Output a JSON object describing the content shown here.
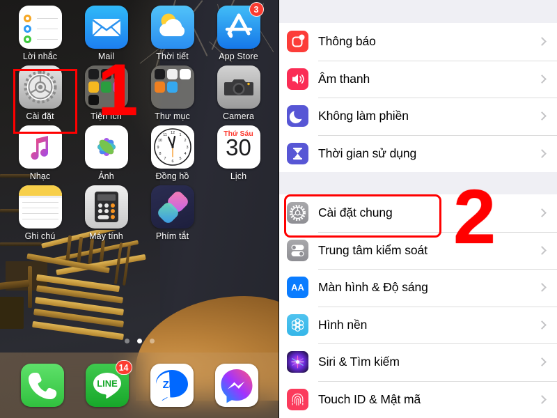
{
  "home_screen": {
    "apps": [
      {
        "id": "reminders",
        "label": "Lời nhắc",
        "icon": "reminders-icon",
        "badge": null
      },
      {
        "id": "mail",
        "label": "Mail",
        "icon": "mail-icon",
        "badge": null
      },
      {
        "id": "weather",
        "label": "Thời tiết",
        "icon": "weather-icon",
        "badge": null
      },
      {
        "id": "appstore",
        "label": "App Store",
        "icon": "app-store-icon",
        "badge": "3"
      },
      {
        "id": "settings",
        "label": "Cài đặt",
        "icon": "settings-gear-icon",
        "badge": null
      },
      {
        "id": "utilities",
        "label": "Tiện ích",
        "icon": "folder-icon",
        "badge": null
      },
      {
        "id": "folder",
        "label": "Thư mục",
        "icon": "folder-icon",
        "badge": null
      },
      {
        "id": "camera",
        "label": "Camera",
        "icon": "camera-icon",
        "badge": null
      },
      {
        "id": "music",
        "label": "Nhạc",
        "icon": "music-note-icon",
        "badge": null
      },
      {
        "id": "photos",
        "label": "Ảnh",
        "icon": "photos-flower-icon",
        "badge": null
      },
      {
        "id": "clock",
        "label": "Đồng hồ",
        "icon": "clock-icon",
        "badge": null
      },
      {
        "id": "calendar",
        "label": "Lịch",
        "icon": "calendar-icon",
        "badge": null
      },
      {
        "id": "notes",
        "label": "Ghi chú",
        "icon": "notes-icon",
        "badge": null
      },
      {
        "id": "calculator",
        "label": "Máy tính",
        "icon": "calculator-icon",
        "badge": null
      },
      {
        "id": "shortcuts",
        "label": "Phím tắt",
        "icon": "shortcuts-icon",
        "badge": null
      }
    ],
    "calendar_icon": {
      "weekday": "Thứ Sáu",
      "day": "30"
    },
    "dock": [
      {
        "id": "phone",
        "label": "Phone",
        "icon": "phone-handset-icon",
        "badge": null
      },
      {
        "id": "line",
        "label": "LINE",
        "icon": "line-chat-icon",
        "badge": "14"
      },
      {
        "id": "zalo",
        "label": "Zalo",
        "icon": "zalo-icon",
        "badge": null
      },
      {
        "id": "messenger",
        "label": "Messenger",
        "icon": "messenger-bolt-icon",
        "badge": null
      }
    ],
    "page_dots": {
      "count": 3,
      "active_index": 1
    }
  },
  "settings_screen": {
    "groups": [
      {
        "id": "group-1",
        "rows": [
          {
            "label": "Thông báo",
            "icon": "notifications-icon",
            "icon_class": "si-notif"
          },
          {
            "label": "Âm thanh",
            "icon": "sounds-speaker-icon",
            "icon_class": "si-sound"
          },
          {
            "label": "Không làm phiền",
            "icon": "do-not-disturb-moon-icon",
            "icon_class": "si-dnd"
          },
          {
            "label": "Thời gian sử dụng",
            "icon": "screen-time-hourglass-icon",
            "icon_class": "si-screentime"
          }
        ]
      },
      {
        "id": "group-2",
        "rows": [
          {
            "label": "Cài đặt chung",
            "icon": "general-gear-icon",
            "icon_class": "si-general"
          },
          {
            "label": "Trung tâm kiểm soát",
            "icon": "control-center-icon",
            "icon_class": "si-control"
          },
          {
            "label": "Màn hình & Độ sáng",
            "icon": "display-brightness-icon",
            "icon_class": "si-display"
          },
          {
            "label": "Hình nền",
            "icon": "wallpaper-icon",
            "icon_class": "si-wallpaper"
          },
          {
            "label": "Siri & Tìm kiếm",
            "icon": "siri-icon",
            "icon_class": "si-siri"
          },
          {
            "label": "Touch ID & Mật mã",
            "icon": "touch-id-fingerprint-icon",
            "icon_class": "si-touchid"
          }
        ]
      }
    ]
  },
  "annotations": {
    "step_one": "1",
    "step_two": "2",
    "highlight_color": "#ff0000"
  }
}
